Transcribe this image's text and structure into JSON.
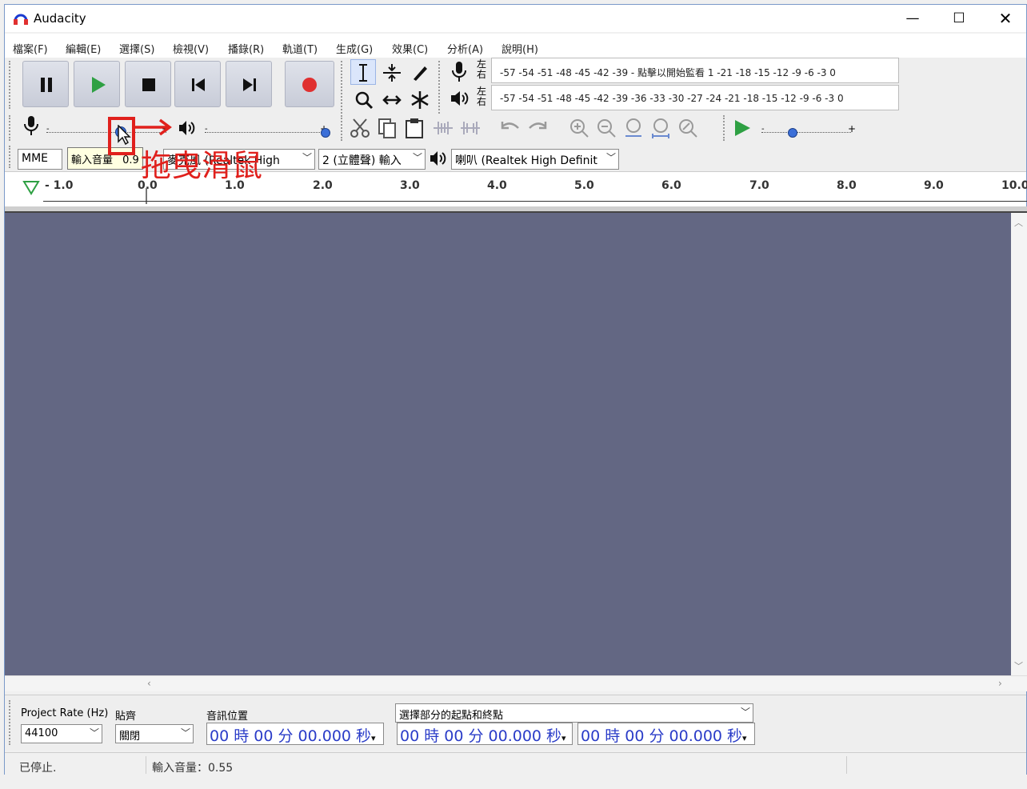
{
  "title": "Audacity",
  "window_controls": {
    "minimize": "—",
    "maximize": "☐",
    "close": "✕"
  },
  "menu": [
    "檔案(F)",
    "編輯(E)",
    "選擇(S)",
    "檢視(V)",
    "播錄(R)",
    "軌道(T)",
    "生成(G)",
    "效果(C)",
    "分析(A)",
    "說明(H)"
  ],
  "meters": {
    "record_scale": "-57 -54 -51 -48 -45 -42 -39 - 點擊以開始監看 1 -21 -18 -15 -12 -9 -6 -3 0",
    "playback_scale": "-57 -54 -51 -48 -45 -42 -39 -36 -33 -30 -27 -24 -21 -18 -15 -12 -9 -6 -3 0",
    "lr_record": "左右",
    "lr_play": "左右"
  },
  "device": {
    "host": "MME",
    "tooltip": "輸入音量",
    "tooltip_value": "0.9",
    "input_device": "麥克風 (Realtek High",
    "channels": "2 (立體聲) 輸入",
    "output_device": "喇叭 (Realtek High Definit"
  },
  "annotation": "拖曳滑鼠",
  "ruler": [
    "- 1.0",
    "0.0",
    "1.0",
    "2.0",
    "3.0",
    "4.0",
    "5.0",
    "6.0",
    "7.0",
    "8.0",
    "9.0",
    "10.0"
  ],
  "selection": {
    "project_rate_label": "Project Rate (Hz)",
    "project_rate_value": "44100",
    "snap_label": "貼齊",
    "snap_value": "關閉",
    "audio_pos_label": "音訊位置",
    "audio_pos_value": "00 時 00 分 00.000 秒",
    "sel_mode": "選擇部分的起點和終點",
    "sel_start": "00 時 00 分 00.000 秒",
    "sel_end": "00 時 00 分 00.000 秒"
  },
  "status": {
    "state": "已停止.",
    "input_level": "輸入音量：0.55"
  },
  "colors": {
    "track_bg": "#636783",
    "annotation": "#e0201c",
    "time_digits": "#2a3cc8",
    "play_green": "#2ea043",
    "record_red": "#e03030"
  }
}
